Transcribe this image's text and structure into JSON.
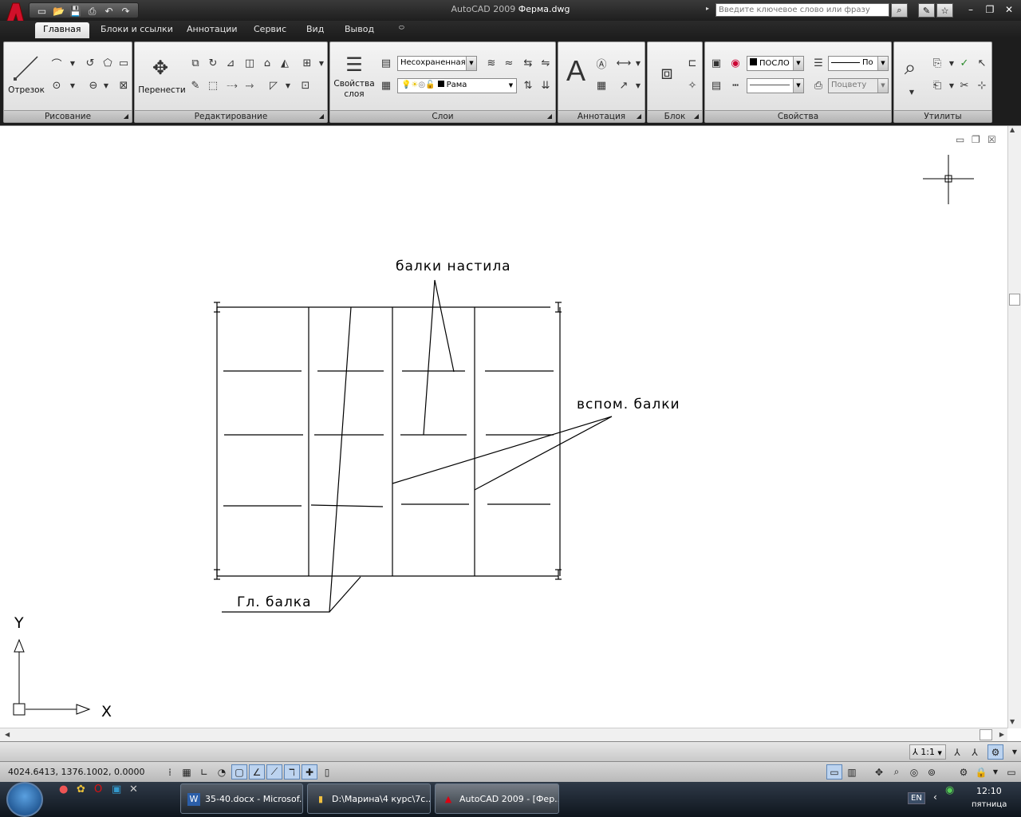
{
  "window": {
    "app_name": "AutoCAD 2009",
    "file_name": "Ферма.dwg",
    "search_placeholder": "Введите ключевое слово или фразу"
  },
  "tabs": [
    "Главная",
    "Блоки и ссылки",
    "Аннотации",
    "Сервис",
    "Вид",
    "Вывод"
  ],
  "ribbon": {
    "draw": {
      "title": "Рисование",
      "line_label": "Отрезок"
    },
    "modify": {
      "title": "Редактирование",
      "move_label": "Перенести"
    },
    "layers": {
      "title": "Слои",
      "props_label_1": "Свойства",
      "props_label_2": "слоя",
      "layer_state": "Несохраненная",
      "current_layer": "Рама"
    },
    "annotation": {
      "title": "Аннотация"
    },
    "block": {
      "title": "Блок"
    },
    "properties": {
      "title": "Свойства",
      "color": "ПОСЛО",
      "lineweight": "По",
      "plotstyle": "Поцвету"
    },
    "utilities": {
      "title": "Утилиты"
    }
  },
  "drawing": {
    "label_deck_beams": "балки настила",
    "label_aux_beams": "вспом. балки",
    "label_main_beam": "Гл. балка",
    "ucs_x": "X",
    "ucs_y": "Y"
  },
  "status": {
    "coords": "4024.6413, 1376.1002, 0.0000",
    "scale": "1:1"
  },
  "taskbar": {
    "tasks": [
      "35-40.docx - Microsof...",
      "D:\\Марина\\4 курс\\7с...",
      "AutoCAD 2009 - [Фер..."
    ],
    "lang": "EN",
    "time": "12:10",
    "day": "пятница"
  }
}
